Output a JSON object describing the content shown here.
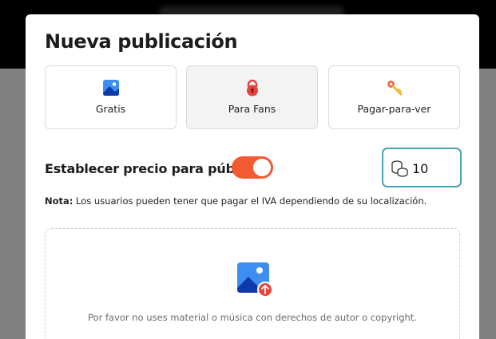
{
  "modal": {
    "title": "Nueva publicación",
    "options": [
      {
        "label": "Gratis",
        "icon": "image-icon",
        "active": false
      },
      {
        "label": "Para Fans",
        "icon": "lock-icon",
        "active": true
      },
      {
        "label": "Pagar-para-ver",
        "icon": "key-icon",
        "active": false
      }
    ],
    "price": {
      "label": "Establecer precio para público",
      "toggle_on": true,
      "value": "10",
      "icon": "coins-icon"
    },
    "note": {
      "prefix": "Nota:",
      "text": " Los usuarios pueden tener que pagar el IVA dependiendo de su localización."
    },
    "upload": {
      "icon": "image-upload-icon",
      "hint": "Por favor no uses material o música con derechos de autor o copyright."
    }
  },
  "colors": {
    "accent": "#f45a32",
    "input_border": "#4aa3b5",
    "active_option_bg": "#f3f3f3"
  }
}
